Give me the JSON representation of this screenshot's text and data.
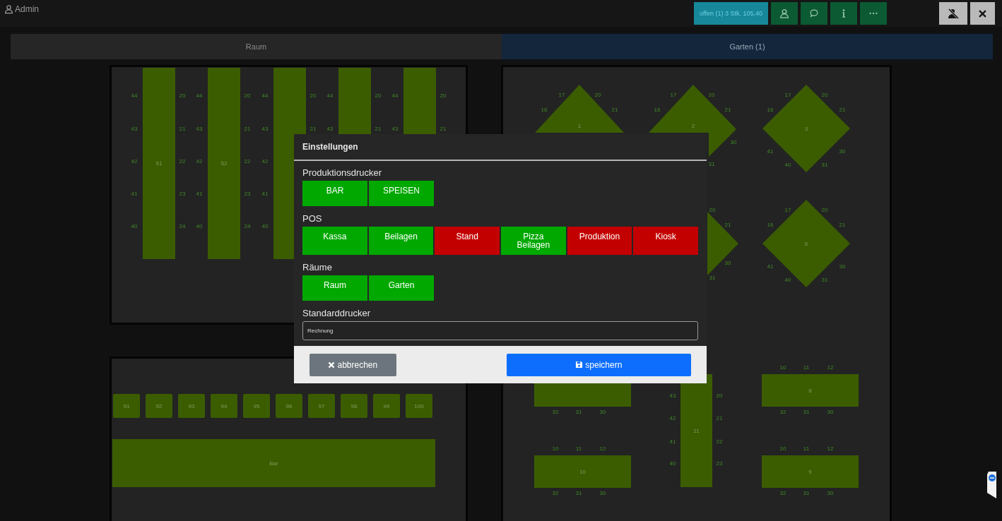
{
  "header": {
    "user": "Admin",
    "order_button": "offen (1) 3 Stk. 105,40"
  },
  "rooms": [
    {
      "label": "Raum",
      "selected": false
    },
    {
      "label": "Garten (1)",
      "selected": true
    }
  ],
  "floor": {
    "tables": [
      {
        "kind": "tall",
        "label": "51",
        "seats": [
          "44",
          "43",
          "42",
          "41",
          "40",
          "20",
          "21",
          "22",
          "23",
          "24"
        ]
      },
      {
        "kind": "tall",
        "label": "52",
        "seats": [
          "44",
          "43",
          "42",
          "41",
          "40",
          "20",
          "21",
          "22",
          "23",
          "24"
        ]
      },
      {
        "kind": "tall",
        "seats": [
          "44",
          "43",
          "42",
          "41",
          "40",
          "20",
          "21"
        ]
      },
      {
        "kind": "tall",
        "seats": [
          "44",
          "43",
          "20",
          "21"
        ]
      },
      {
        "kind": "tall",
        "seats": [
          "44",
          "43",
          "20",
          "21"
        ]
      },
      {
        "kind": "triangle",
        "label": "1",
        "seats": [
          "17",
          "20",
          "16",
          "21"
        ]
      },
      {
        "kind": "arrow",
        "label": "2",
        "seats": [
          "17",
          "20",
          "16",
          "21",
          "30",
          "31"
        ]
      },
      {
        "kind": "diamond",
        "label": "3",
        "seats": [
          "17",
          "20",
          "16",
          "21",
          "41",
          "30",
          "40",
          "31"
        ]
      },
      {
        "kind": "wedge",
        "seats": [
          "20",
          "21",
          "30",
          "31"
        ]
      },
      {
        "kind": "diamond",
        "label": "6",
        "seats": [
          "17",
          "20",
          "16",
          "21",
          "41",
          "30",
          "40",
          "31"
        ]
      },
      {
        "kind": "wide",
        "seats": [
          "32",
          "31",
          "30"
        ]
      },
      {
        "kind": "wide",
        "label": "10",
        "seats": [
          "10",
          "11",
          "12",
          "32",
          "31",
          "30"
        ]
      },
      {
        "kind": "tall",
        "label": "11",
        "seats": [
          "43",
          "42",
          "41",
          "40",
          "20",
          "21",
          "22",
          "23"
        ]
      },
      {
        "kind": "wide",
        "label": "8",
        "seats": [
          "10",
          "11",
          "12",
          "32",
          "31",
          "30"
        ]
      },
      {
        "kind": "wide",
        "label": "9",
        "seats": [
          "10",
          "11",
          "12",
          "32",
          "31",
          "30"
        ]
      },
      {
        "kind": "square",
        "label": "91"
      },
      {
        "kind": "square",
        "label": "92"
      },
      {
        "kind": "square",
        "label": "93"
      },
      {
        "kind": "square",
        "label": "94"
      },
      {
        "kind": "square",
        "label": "95"
      },
      {
        "kind": "square",
        "label": "96"
      },
      {
        "kind": "square",
        "label": "97"
      },
      {
        "kind": "square",
        "label": "98"
      },
      {
        "kind": "square",
        "label": "99"
      },
      {
        "kind": "square",
        "label": "100"
      },
      {
        "kind": "bar",
        "label": "Bar"
      }
    ]
  },
  "settings": {
    "title": "Einstellungen",
    "sections": [
      {
        "title": "Produktionsdrucker",
        "options": [
          {
            "label": "BAR",
            "on": true
          },
          {
            "label": "SPEISEN",
            "on": true
          }
        ]
      },
      {
        "title": "POS",
        "options": [
          {
            "label": "Kassa",
            "on": true
          },
          {
            "label": "Beilagen",
            "on": true
          },
          {
            "label": "Stand",
            "on": false
          },
          {
            "label": "Pizza Beilagen",
            "on": true
          },
          {
            "label": "Produktion",
            "on": false
          },
          {
            "label": "Kiosk",
            "on": false
          }
        ]
      },
      {
        "title": "Räume",
        "options": [
          {
            "label": "Raum",
            "on": true
          },
          {
            "label": "Garten",
            "on": true
          }
        ]
      }
    ],
    "default_printer": {
      "label": "Standarddrucker",
      "value": "Rechnung"
    },
    "cancel_button": "abbrechen",
    "save_button": "speichern"
  }
}
